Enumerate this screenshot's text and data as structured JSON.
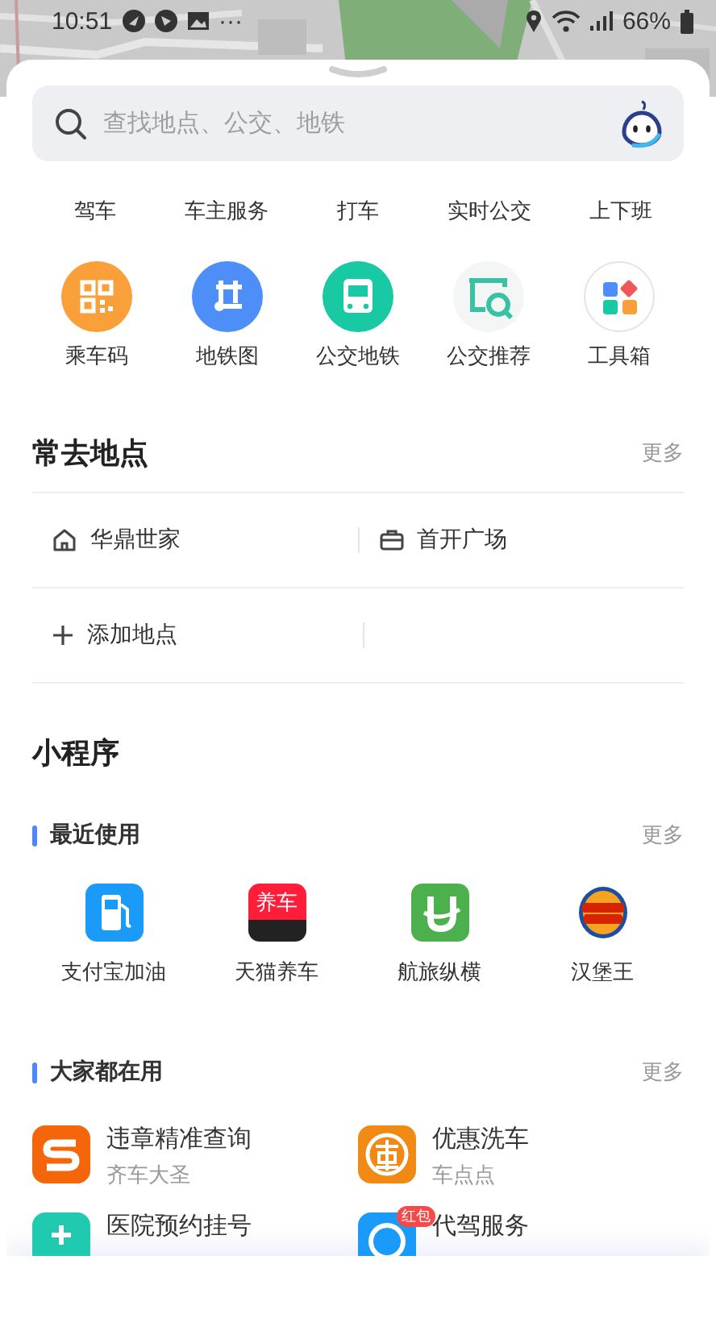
{
  "status_bar": {
    "time": "10:51",
    "more": "···",
    "battery": "66%"
  },
  "search": {
    "placeholder": "查找地点、公交、地铁"
  },
  "quick_tabs": [
    "驾车",
    "车主服务",
    "打车",
    "实时公交",
    "上下班"
  ],
  "shortcuts": [
    {
      "label": "乘车码"
    },
    {
      "label": "地铁图"
    },
    {
      "label": "公交地铁"
    },
    {
      "label": "公交推荐"
    },
    {
      "label": "工具箱"
    }
  ],
  "frequent_places": {
    "title": "常去地点",
    "more": "更多",
    "items": [
      {
        "kind": "home",
        "label": "华鼎世家"
      },
      {
        "kind": "work",
        "label": "首开广场"
      },
      {
        "kind": "add",
        "label": "添加地点"
      }
    ]
  },
  "mini_programs": {
    "title": "小程序",
    "recent": {
      "title": "最近使用",
      "more": "更多",
      "items": [
        {
          "label": "支付宝加油"
        },
        {
          "label": "天猫养车",
          "icon_text": "养车"
        },
        {
          "label": "航旅纵横"
        },
        {
          "label": "汉堡王"
        }
      ]
    },
    "popular": {
      "title": "大家都在用",
      "more": "更多",
      "items": [
        {
          "title": "违章精准查询",
          "subtitle": "齐车大圣"
        },
        {
          "title": "优惠洗车",
          "subtitle": "车点点"
        },
        {
          "title": "医院预约挂号"
        },
        {
          "title": "代驾服务",
          "badge": "红包"
        }
      ]
    }
  }
}
